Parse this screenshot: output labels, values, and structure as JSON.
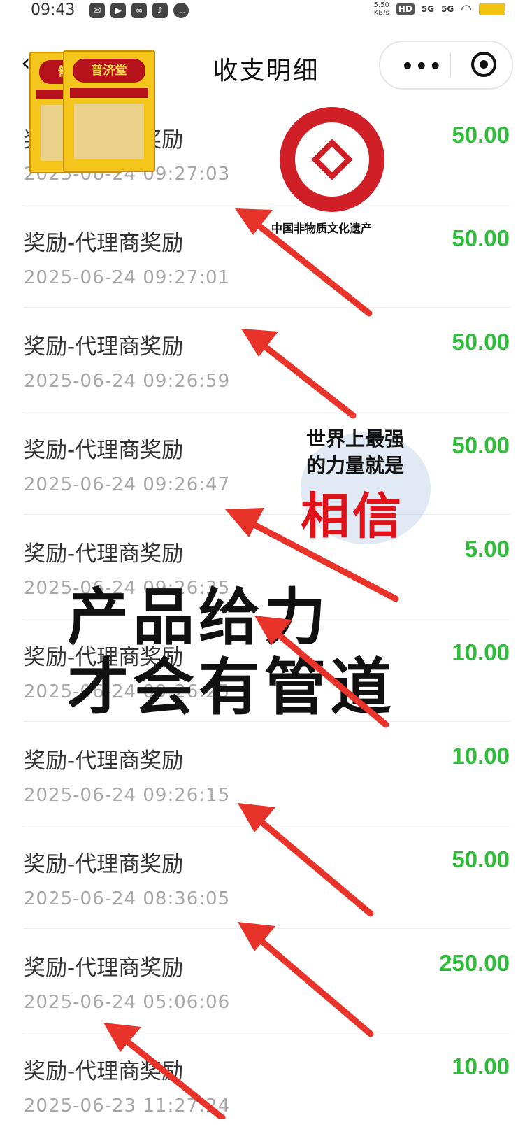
{
  "status_bar": {
    "time": "09:43",
    "app_icons": [
      "message-icon",
      "play-icon",
      "link-icon",
      "tiktok-icon",
      "chat-icon"
    ],
    "net_speed_value": "5.50",
    "net_speed_unit": "KB/s",
    "hd_label": "HD",
    "signal_1": "5G",
    "signal_2": "5G"
  },
  "nav": {
    "title": "收支明细",
    "more_glyph": "•••"
  },
  "records": [
    {
      "title": "奖励-代理商奖励",
      "time": "2025-06-24 09:27:03",
      "amount": "50.00"
    },
    {
      "title": "奖励-代理商奖励",
      "time": "2025-06-24 09:27:01",
      "amount": "50.00"
    },
    {
      "title": "奖励-代理商奖励",
      "time": "2025-06-24 09:26:59",
      "amount": "50.00"
    },
    {
      "title": "奖励-代理商奖励",
      "time": "2025-06-24 09:26:47",
      "amount": "50.00"
    },
    {
      "title": "奖励-代理商奖励",
      "time": "2025-06-24 09:26:35",
      "amount": "5.00"
    },
    {
      "title": "奖励-代理商奖励",
      "time": "2025-06-24 09:26:25",
      "amount": "10.00"
    },
    {
      "title": "奖励-代理商奖励",
      "time": "2025-06-24 09:26:15",
      "amount": "10.00"
    },
    {
      "title": "奖励-代理商奖励",
      "time": "2025-06-24 08:36:05",
      "amount": "50.00"
    },
    {
      "title": "奖励-代理商奖励",
      "time": "2025-06-24 05:06:06",
      "amount": "250.00"
    },
    {
      "title": "奖励-代理商奖励",
      "time": "2025-06-23 11:27:24",
      "amount": "10.00"
    }
  ],
  "overlays": {
    "product_label": "普济堂",
    "heritage_caption": "中国非物质文化遗产",
    "quote_line1": "世界上最强",
    "quote_line2": "的力量就是",
    "quote_big": "相信",
    "slogan_line1": "产品给力",
    "slogan_line2": "才会有管道"
  },
  "colors": {
    "amount_green": "#2dbd39",
    "arrow_red": "#e8332a",
    "quote_red": "#e0131b"
  }
}
